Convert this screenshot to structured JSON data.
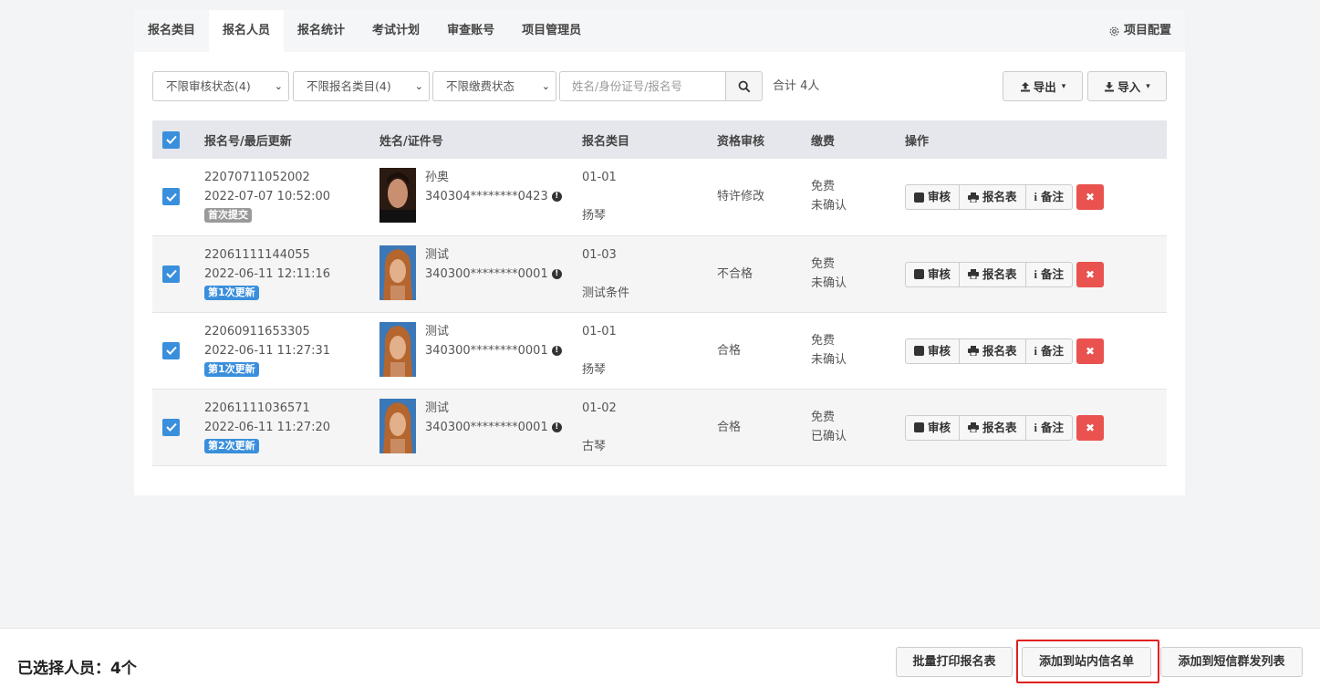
{
  "tabs": [
    "报名类目",
    "报名人员",
    "报名统计",
    "考试计划",
    "审查账号",
    "项目管理员"
  ],
  "project_config_label": "项目配置",
  "filters": {
    "review_status": "不限审核状态(4)",
    "category": "不限报名类目(4)",
    "payment": "不限缴费状态",
    "search_placeholder": "姓名/身份证号/报名号",
    "total": "合计 4人"
  },
  "export_label": "导出",
  "import_label": "导入",
  "columns": [
    "报名号/最后更新",
    "姓名/证件号",
    "报名类目",
    "资格审核",
    "缴费",
    "操作"
  ],
  "rows": [
    {
      "id": "22070711052002",
      "updated": "2022-07-07 10:52:00",
      "badge": "首次提交",
      "badge_color": "#9a9a9a",
      "name": "孙奥",
      "cert": "340304********0423",
      "cat_code": "01-01",
      "cat_name": "扬琴",
      "qual": "特许修改",
      "fee": "免费",
      "fee_status": "未确认"
    },
    {
      "id": "22061111144055",
      "updated": "2022-06-11 12:11:16",
      "badge": "第1次更新",
      "badge_color": "#3a8fdc",
      "name": "测试",
      "cert": "340300********0001",
      "cat_code": "01-03",
      "cat_name": "测试条件",
      "qual": "不合格",
      "fee": "免费",
      "fee_status": "未确认"
    },
    {
      "id": "22060911653305",
      "updated": "2022-06-11 11:27:31",
      "badge": "第1次更新",
      "badge_color": "#3a8fdc",
      "name": "测试",
      "cert": "340300********0001",
      "cat_code": "01-01",
      "cat_name": "扬琴",
      "qual": "合格",
      "fee": "免费",
      "fee_status": "未确认"
    },
    {
      "id": "22061111036571",
      "updated": "2022-06-11 11:27:20",
      "badge": "第2次更新",
      "badge_color": "#3a8fdc",
      "name": "测试",
      "cert": "340300********0001",
      "cat_code": "01-02",
      "cat_name": "古琴",
      "qual": "合格",
      "fee": "免费",
      "fee_status": "已确认"
    }
  ],
  "action_labels": {
    "review": "审核",
    "form": "报名表",
    "note": "备注"
  },
  "footer": {
    "selected": "已选择人员：4个",
    "batch_print": "批量打印报名表",
    "add_inbox": "添加到站内信名单",
    "add_sms": "添加到短信群发列表"
  }
}
